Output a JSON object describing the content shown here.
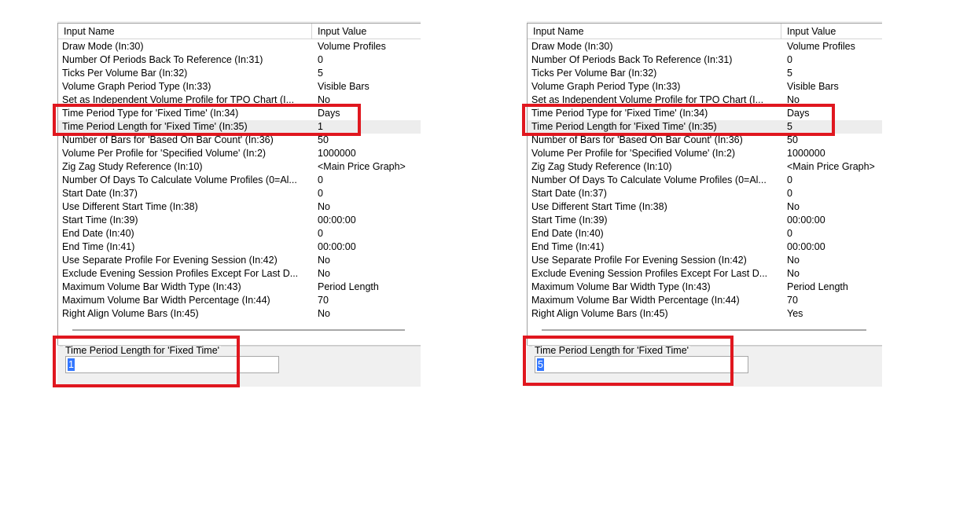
{
  "accent": {
    "highlight_box": "#e0171f",
    "selection": "#3377ff"
  },
  "panels": [
    {
      "header": {
        "name": "Input Name",
        "value": "Input Value"
      },
      "rows": [
        {
          "name": "Draw Mode   (In:30)",
          "value": "Volume Profiles"
        },
        {
          "name": "Number Of Periods Back To Reference   (In:31)",
          "value": "0"
        },
        {
          "name": "Ticks Per Volume Bar   (In:32)",
          "value": "5"
        },
        {
          "name": "Volume Graph Period Type   (In:33)",
          "value": "Visible Bars"
        },
        {
          "name": "Set as Independent Volume Profile for TPO Chart   (I...",
          "value": "No"
        },
        {
          "name": "Time Period Type for 'Fixed Time'   (In:34)",
          "value": "Days"
        },
        {
          "name": "Time Period Length for 'Fixed Time'   (In:35)",
          "value": "1"
        },
        {
          "name": "Number of Bars for 'Based On Bar Count'   (In:36)",
          "value": "50"
        },
        {
          "name": "Volume Per Profile for 'Specified Volume'   (In:2)",
          "value": "1000000"
        },
        {
          "name": "Zig Zag Study Reference   (In:10)",
          "value": "<Main Price Graph>"
        },
        {
          "name": "Number Of Days To Calculate Volume Profiles (0=Al...",
          "value": "0"
        },
        {
          "name": "Start Date   (In:37)",
          "value": "0"
        },
        {
          "name": "Use Different Start Time   (In:38)",
          "value": "No"
        },
        {
          "name": "Start Time   (In:39)",
          "value": "00:00:00"
        },
        {
          "name": "End Date   (In:40)",
          "value": "0"
        },
        {
          "name": "End Time   (In:41)",
          "value": "00:00:00"
        },
        {
          "name": "Use Separate Profile For Evening Session   (In:42)",
          "value": "No"
        },
        {
          "name": "Exclude Evening Session Profiles Except For Last D...",
          "value": "No"
        },
        {
          "name": "Maximum Volume Bar Width Type   (In:43)",
          "value": "Period Length"
        },
        {
          "name": "Maximum Volume Bar Width Percentage   (In:44)",
          "value": "70"
        },
        {
          "name": "Right Align Volume Bars   (In:45)",
          "value": "No"
        }
      ],
      "editor": {
        "label": "Time Period Length for 'Fixed Time'",
        "value": "1"
      }
    },
    {
      "header": {
        "name": "Input Name",
        "value": "Input Value"
      },
      "rows": [
        {
          "name": "Draw Mode   (In:30)",
          "value": "Volume Profiles"
        },
        {
          "name": "Number Of Periods Back To Reference   (In:31)",
          "value": "0"
        },
        {
          "name": "Ticks Per Volume Bar   (In:32)",
          "value": "5"
        },
        {
          "name": "Volume Graph Period Type   (In:33)",
          "value": "Visible Bars"
        },
        {
          "name": "Set as Independent Volume Profile for TPO Chart   (I...",
          "value": "No"
        },
        {
          "name": "Time Period Type for 'Fixed Time'   (In:34)",
          "value": "Days"
        },
        {
          "name": "Time Period Length for 'Fixed Time'   (In:35)",
          "value": "5"
        },
        {
          "name": "Number of Bars for 'Based On Bar Count'   (In:36)",
          "value": "50"
        },
        {
          "name": "Volume Per Profile for 'Specified Volume'   (In:2)",
          "value": "1000000"
        },
        {
          "name": "Zig Zag Study Reference   (In:10)",
          "value": "<Main Price Graph>"
        },
        {
          "name": "Number Of Days To Calculate Volume Profiles (0=Al...",
          "value": "0"
        },
        {
          "name": "Start Date   (In:37)",
          "value": "0"
        },
        {
          "name": "Use Different Start Time   (In:38)",
          "value": "No"
        },
        {
          "name": "Start Time   (In:39)",
          "value": "00:00:00"
        },
        {
          "name": "End Date   (In:40)",
          "value": "0"
        },
        {
          "name": "End Time   (In:41)",
          "value": "00:00:00"
        },
        {
          "name": "Use Separate Profile For Evening Session   (In:42)",
          "value": "No"
        },
        {
          "name": "Exclude Evening Session Profiles Except For Last D...",
          "value": "No"
        },
        {
          "name": "Maximum Volume Bar Width Type   (In:43)",
          "value": "Period Length"
        },
        {
          "name": "Maximum Volume Bar Width Percentage   (In:44)",
          "value": "70"
        },
        {
          "name": "Right Align Volume Bars   (In:45)",
          "value": "Yes"
        }
      ],
      "editor": {
        "label": "Time Period Length for 'Fixed Time'",
        "value": "5"
      }
    }
  ]
}
